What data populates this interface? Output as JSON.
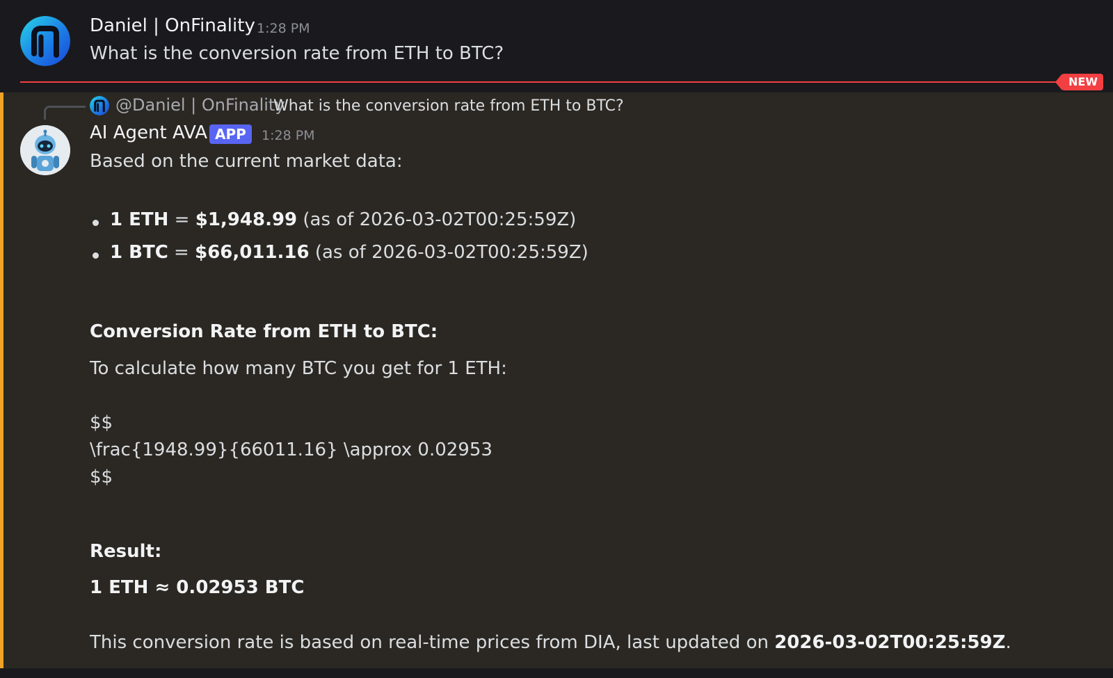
{
  "messages": {
    "first": {
      "username": "Daniel | OnFinality",
      "timestamp": "1:28 PM",
      "text": "What is the conversion rate from ETH to BTC?"
    },
    "divider": {
      "badge": "NEW",
      "color": "#f23f42"
    },
    "reply": {
      "reply_to_name": "@Daniel | OnFinality",
      "reply_to_text": "What is the conversion rate from ETH to BTC?",
      "username": "AI Agent AVA",
      "tag": "APP",
      "timestamp": "1:28 PM",
      "intro": "Based on the current market data:",
      "bullets": [
        {
          "asset": "1 ETH",
          "eq": " = ",
          "price": "$1,948.99",
          "note": " (as of 2026-03-02T00:25:59Z)"
        },
        {
          "asset": "1 BTC",
          "eq": " = ",
          "price": "$66,011.16",
          "note": " (as of 2026-03-02T00:25:59Z)"
        }
      ],
      "heading": "Conversion Rate from ETH to BTC:",
      "calc_intro": "To calculate how many BTC you get for 1 ETH:",
      "latex_open": "$$",
      "latex_expr": "\\frac{1948.99}{66011.16} \\approx 0.02953",
      "latex_close": "$$",
      "result_label": "Result:",
      "result_value": "1 ETH ≈ 0.02953 BTC",
      "footer_prefix": "This conversion rate is based on real-time prices from DIA, last updated on ",
      "footer_time": "2026-03-02T00:25:59Z",
      "footer_suffix": "."
    }
  },
  "colors": {
    "background": "#1a1a1e",
    "highlight_background": "#2b2823",
    "mention_bar": "#f0a329",
    "app_tag": "#5865f2",
    "new_divider": "#f23f42"
  },
  "icons": {
    "daniel_avatar": "onfinality-logo-icon",
    "ava_avatar": "robot-avatar-icon"
  }
}
